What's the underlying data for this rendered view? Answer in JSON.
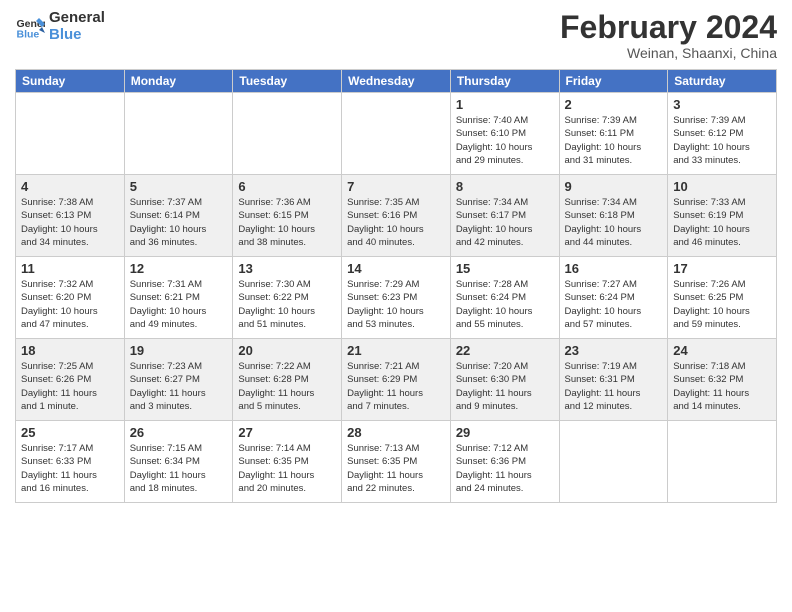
{
  "logo": {
    "text_general": "General",
    "text_blue": "Blue"
  },
  "title": "February 2024",
  "subtitle": "Weinan, Shaanxi, China",
  "headers": [
    "Sunday",
    "Monday",
    "Tuesday",
    "Wednesday",
    "Thursday",
    "Friday",
    "Saturday"
  ],
  "weeks": [
    [
      {
        "day": "",
        "info": ""
      },
      {
        "day": "",
        "info": ""
      },
      {
        "day": "",
        "info": ""
      },
      {
        "day": "",
        "info": ""
      },
      {
        "day": "1",
        "info": "Sunrise: 7:40 AM\nSunset: 6:10 PM\nDaylight: 10 hours\nand 29 minutes."
      },
      {
        "day": "2",
        "info": "Sunrise: 7:39 AM\nSunset: 6:11 PM\nDaylight: 10 hours\nand 31 minutes."
      },
      {
        "day": "3",
        "info": "Sunrise: 7:39 AM\nSunset: 6:12 PM\nDaylight: 10 hours\nand 33 minutes."
      }
    ],
    [
      {
        "day": "4",
        "info": "Sunrise: 7:38 AM\nSunset: 6:13 PM\nDaylight: 10 hours\nand 34 minutes."
      },
      {
        "day": "5",
        "info": "Sunrise: 7:37 AM\nSunset: 6:14 PM\nDaylight: 10 hours\nand 36 minutes."
      },
      {
        "day": "6",
        "info": "Sunrise: 7:36 AM\nSunset: 6:15 PM\nDaylight: 10 hours\nand 38 minutes."
      },
      {
        "day": "7",
        "info": "Sunrise: 7:35 AM\nSunset: 6:16 PM\nDaylight: 10 hours\nand 40 minutes."
      },
      {
        "day": "8",
        "info": "Sunrise: 7:34 AM\nSunset: 6:17 PM\nDaylight: 10 hours\nand 42 minutes."
      },
      {
        "day": "9",
        "info": "Sunrise: 7:34 AM\nSunset: 6:18 PM\nDaylight: 10 hours\nand 44 minutes."
      },
      {
        "day": "10",
        "info": "Sunrise: 7:33 AM\nSunset: 6:19 PM\nDaylight: 10 hours\nand 46 minutes."
      }
    ],
    [
      {
        "day": "11",
        "info": "Sunrise: 7:32 AM\nSunset: 6:20 PM\nDaylight: 10 hours\nand 47 minutes."
      },
      {
        "day": "12",
        "info": "Sunrise: 7:31 AM\nSunset: 6:21 PM\nDaylight: 10 hours\nand 49 minutes."
      },
      {
        "day": "13",
        "info": "Sunrise: 7:30 AM\nSunset: 6:22 PM\nDaylight: 10 hours\nand 51 minutes."
      },
      {
        "day": "14",
        "info": "Sunrise: 7:29 AM\nSunset: 6:23 PM\nDaylight: 10 hours\nand 53 minutes."
      },
      {
        "day": "15",
        "info": "Sunrise: 7:28 AM\nSunset: 6:24 PM\nDaylight: 10 hours\nand 55 minutes."
      },
      {
        "day": "16",
        "info": "Sunrise: 7:27 AM\nSunset: 6:24 PM\nDaylight: 10 hours\nand 57 minutes."
      },
      {
        "day": "17",
        "info": "Sunrise: 7:26 AM\nSunset: 6:25 PM\nDaylight: 10 hours\nand 59 minutes."
      }
    ],
    [
      {
        "day": "18",
        "info": "Sunrise: 7:25 AM\nSunset: 6:26 PM\nDaylight: 11 hours\nand 1 minute."
      },
      {
        "day": "19",
        "info": "Sunrise: 7:23 AM\nSunset: 6:27 PM\nDaylight: 11 hours\nand 3 minutes."
      },
      {
        "day": "20",
        "info": "Sunrise: 7:22 AM\nSunset: 6:28 PM\nDaylight: 11 hours\nand 5 minutes."
      },
      {
        "day": "21",
        "info": "Sunrise: 7:21 AM\nSunset: 6:29 PM\nDaylight: 11 hours\nand 7 minutes."
      },
      {
        "day": "22",
        "info": "Sunrise: 7:20 AM\nSunset: 6:30 PM\nDaylight: 11 hours\nand 9 minutes."
      },
      {
        "day": "23",
        "info": "Sunrise: 7:19 AM\nSunset: 6:31 PM\nDaylight: 11 hours\nand 12 minutes."
      },
      {
        "day": "24",
        "info": "Sunrise: 7:18 AM\nSunset: 6:32 PM\nDaylight: 11 hours\nand 14 minutes."
      }
    ],
    [
      {
        "day": "25",
        "info": "Sunrise: 7:17 AM\nSunset: 6:33 PM\nDaylight: 11 hours\nand 16 minutes."
      },
      {
        "day": "26",
        "info": "Sunrise: 7:15 AM\nSunset: 6:34 PM\nDaylight: 11 hours\nand 18 minutes."
      },
      {
        "day": "27",
        "info": "Sunrise: 7:14 AM\nSunset: 6:35 PM\nDaylight: 11 hours\nand 20 minutes."
      },
      {
        "day": "28",
        "info": "Sunrise: 7:13 AM\nSunset: 6:35 PM\nDaylight: 11 hours\nand 22 minutes."
      },
      {
        "day": "29",
        "info": "Sunrise: 7:12 AM\nSunset: 6:36 PM\nDaylight: 11 hours\nand 24 minutes."
      },
      {
        "day": "",
        "info": ""
      },
      {
        "day": "",
        "info": ""
      }
    ]
  ]
}
